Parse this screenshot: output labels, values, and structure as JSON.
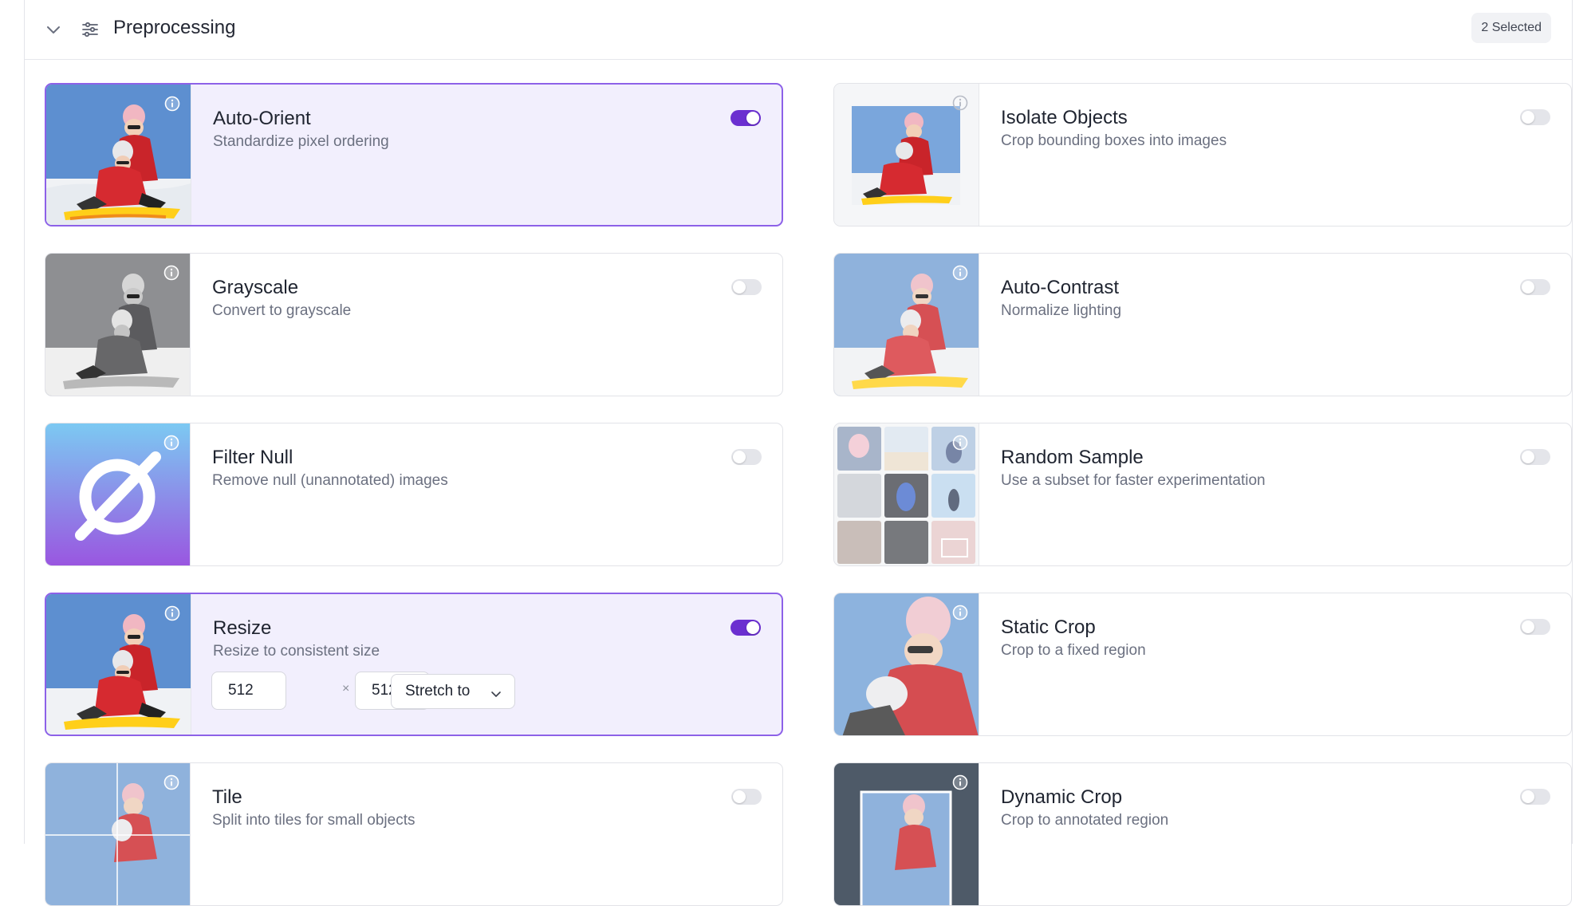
{
  "section": {
    "title": "Preprocessing",
    "selected_badge": "2 Selected",
    "collapse_icon": "chevron-down-icon",
    "section_icon": "sliders-icon"
  },
  "options": [
    {
      "title": "Auto-Orient",
      "subtitle": "Standardize pixel ordering",
      "enabled": true
    },
    {
      "title": "Isolate Objects",
      "subtitle": "Crop bounding boxes into images",
      "enabled": false
    },
    {
      "title": "Grayscale",
      "subtitle": "Convert to grayscale",
      "enabled": false
    },
    {
      "title": "Auto-Contrast",
      "subtitle": "Normalize lighting",
      "enabled": false
    },
    {
      "title": "Filter Null",
      "subtitle": "Remove null (unannotated) images",
      "enabled": false
    },
    {
      "title": "Random Sample",
      "subtitle": "Use a subset for faster experimentation",
      "enabled": false
    },
    {
      "title": "Resize",
      "subtitle": "Resize to consistent size",
      "enabled": true
    },
    {
      "title": "Static Crop",
      "subtitle": "Crop to a fixed region",
      "enabled": false
    },
    {
      "title": "Tile",
      "subtitle": "Split into tiles for small objects",
      "enabled": false
    },
    {
      "title": "Dynamic Crop",
      "subtitle": "Crop to annotated region",
      "enabled": false
    }
  ],
  "resize": {
    "width": "512",
    "height": "512",
    "separator": "×",
    "mode": "Stretch to"
  },
  "colors": {
    "accent": "#6b2fd0",
    "active_border": "#8d61e8",
    "active_bg": "#f2effd"
  }
}
